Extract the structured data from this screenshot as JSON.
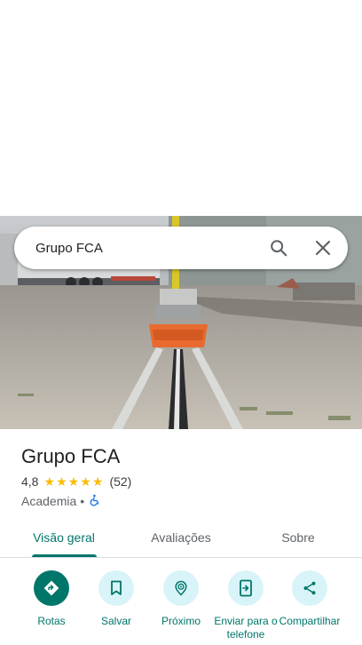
{
  "search": {
    "query": "Grupo FCA"
  },
  "place": {
    "title": "Grupo FCA",
    "rating": "4,8",
    "stars": 5,
    "review_count": "(52)",
    "category": "Academia",
    "separator": "•"
  },
  "tabs": [
    {
      "label": "Visão geral",
      "active": true
    },
    {
      "label": "Avaliações",
      "active": false
    },
    {
      "label": "Sobre",
      "active": false
    }
  ],
  "actions": [
    {
      "label": "Rotas",
      "icon": "directions-icon"
    },
    {
      "label": "Salvar",
      "icon": "bookmark-icon"
    },
    {
      "label": "Próximo",
      "icon": "nearby-icon"
    },
    {
      "label": "Enviar para o telefone",
      "icon": "send-to-phone-icon"
    },
    {
      "label": "Compartilhar",
      "icon": "share-icon"
    }
  ],
  "colors": {
    "accent": "#00766a",
    "action_bg": "#d9f4f8",
    "star": "#fbbc04"
  }
}
